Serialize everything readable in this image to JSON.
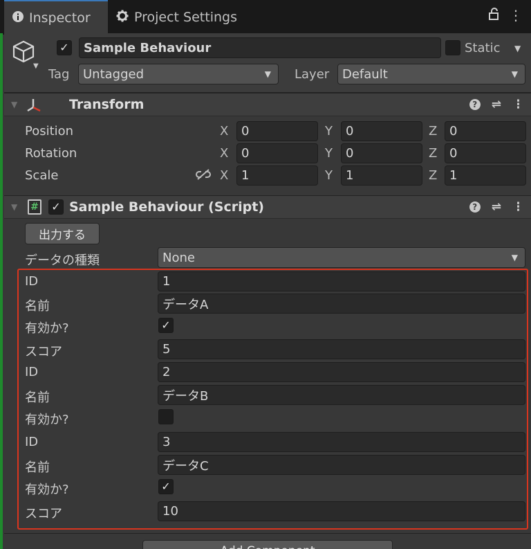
{
  "tabs": {
    "inspector": "Inspector",
    "project_settings": "Project Settings"
  },
  "header": {
    "object_name": "Sample Behaviour",
    "static_label": "Static",
    "tag_label": "Tag",
    "tag_value": "Untagged",
    "layer_label": "Layer",
    "layer_value": "Default"
  },
  "transform": {
    "title": "Transform",
    "rows": [
      {
        "label": "Position",
        "x": "0",
        "y": "0",
        "z": "0"
      },
      {
        "label": "Rotation",
        "x": "0",
        "y": "0",
        "z": "0"
      },
      {
        "label": "Scale",
        "x": "1",
        "y": "1",
        "z": "1"
      }
    ],
    "axis_x": "X",
    "axis_y": "Y",
    "axis_z": "Z"
  },
  "script": {
    "title": "Sample Behaviour (Script)",
    "output_button": "出力する",
    "data_type_label": "データの種類",
    "data_type_value": "None",
    "items": [
      {
        "id_label": "ID",
        "id": "1",
        "name_label": "名前",
        "name": "データA",
        "valid_label": "有効か?",
        "valid": true,
        "score_label": "スコア",
        "score": "5"
      },
      {
        "id_label": "ID",
        "id": "2",
        "name_label": "名前",
        "name": "データB",
        "valid_label": "有効か?",
        "valid": false
      },
      {
        "id_label": "ID",
        "id": "3",
        "name_label": "名前",
        "name": "データC",
        "valid_label": "有効か?",
        "valid": true,
        "score_label": "スコア",
        "score": "10"
      }
    ]
  },
  "add_component": "Add Component",
  "colors": {
    "highlight_border": "#d8351f",
    "panel_bg": "#383838",
    "tab_accent": "#3a79bb"
  }
}
